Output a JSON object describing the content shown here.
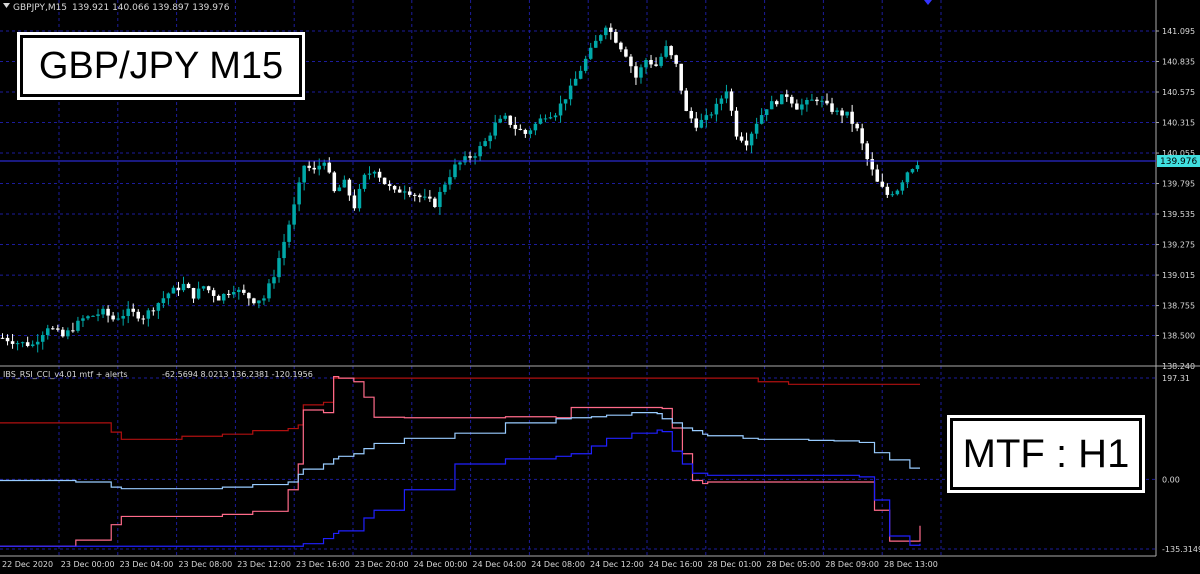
{
  "window": {
    "symbol_header": "GBPJPY,M15",
    "ohlc": "139.921 140.066 139.897 139.976",
    "indicator_header": "IBS_RSI_CCI_v4.01 mtf + alerts",
    "indicator_values": "-62.5694 8.0213 136.2381 -120.1956"
  },
  "overlays": {
    "main_label": "GBP/JPY M15",
    "mtf_label": "MTF : H1"
  },
  "colors": {
    "background": "#000000",
    "grid": "#1c1c9c",
    "axis_text": "#d8d8d8",
    "bull_candle": "#00a8a8",
    "bear_candle": "#ffffff",
    "price_line": "#3333ff",
    "current_price_bg": "#40e0e0",
    "ibs_line": "#b01010",
    "rsi_line": "#ff6b8a",
    "cci_line": "#99ccff",
    "ind4_line": "#2020ff"
  },
  "chart_data": [
    {
      "type": "candlestick",
      "title": "GBPJPY,M15",
      "current_price": 139.976,
      "current_price_label": "139.976",
      "y_ticks": [
        "141.095",
        "140.835",
        "140.575",
        "140.315",
        "140.055",
        "139.795",
        "139.535",
        "139.275",
        "139.015",
        "138.755",
        "138.500",
        "138.240"
      ],
      "ylim": [
        138.24,
        141.3
      ],
      "x_labels": [
        "22 Dec 2020",
        "23 Dec 00:00",
        "23 Dec 04:00",
        "23 Dec 08:00",
        "23 Dec 12:00",
        "23 Dec 16:00",
        "23 Dec 20:00",
        "24 Dec 00:00",
        "24 Dec 04:00",
        "24 Dec 08:00",
        "24 Dec 12:00",
        "24 Dec 16:00",
        "28 Dec 01:00",
        "28 Dec 05:00",
        "28 Dec 09:00",
        "28 Dec 13:00"
      ],
      "close_path": [
        [
          0,
          138.48
        ],
        [
          3,
          138.44
        ],
        [
          6,
          138.42
        ],
        [
          9,
          138.58
        ],
        [
          12,
          138.49
        ],
        [
          16,
          138.64
        ],
        [
          20,
          138.7
        ],
        [
          22,
          138.64
        ],
        [
          25,
          138.7
        ],
        [
          28,
          138.66
        ],
        [
          30,
          138.74
        ],
        [
          33,
          138.86
        ],
        [
          36,
          138.93
        ],
        [
          38,
          138.84
        ],
        [
          40,
          138.92
        ],
        [
          43,
          138.82
        ],
        [
          46,
          138.9
        ],
        [
          50,
          138.8
        ],
        [
          52,
          138.82
        ],
        [
          54,
          139.02
        ],
        [
          56,
          139.3
        ],
        [
          58,
          139.6
        ],
        [
          60,
          139.95
        ],
        [
          62,
          139.9
        ],
        [
          64,
          140.0
        ],
        [
          66,
          139.72
        ],
        [
          68,
          139.8
        ],
        [
          70,
          139.6
        ],
        [
          72,
          139.85
        ],
        [
          74,
          139.92
        ],
        [
          76,
          139.8
        ],
        [
          78,
          139.72
        ],
        [
          80,
          139.75
        ],
        [
          83,
          139.68
        ],
        [
          86,
          139.62
        ],
        [
          88,
          139.8
        ],
        [
          90,
          139.94
        ],
        [
          92,
          140.0
        ],
        [
          94,
          140.05
        ],
        [
          96,
          140.15
        ],
        [
          98,
          140.3
        ],
        [
          100,
          140.35
        ],
        [
          102,
          140.27
        ],
        [
          104,
          140.22
        ],
        [
          106,
          140.3
        ],
        [
          108,
          140.38
        ],
        [
          110,
          140.4
        ],
        [
          113,
          140.6
        ],
        [
          116,
          140.85
        ],
        [
          118,
          141.0
        ],
        [
          120,
          141.15
        ],
        [
          122,
          141.02
        ],
        [
          124,
          140.9
        ],
        [
          126,
          140.7
        ],
        [
          128,
          140.85
        ],
        [
          130,
          140.8
        ],
        [
          132,
          140.95
        ],
        [
          134,
          140.8
        ],
        [
          136,
          140.4
        ],
        [
          138,
          140.3
        ],
        [
          140,
          140.35
        ],
        [
          142,
          140.45
        ],
        [
          144,
          140.6
        ],
        [
          146,
          140.22
        ],
        [
          148,
          140.15
        ],
        [
          150,
          140.32
        ],
        [
          152,
          140.45
        ],
        [
          154,
          140.5
        ],
        [
          156,
          140.55
        ],
        [
          158,
          140.45
        ],
        [
          160,
          140.48
        ],
        [
          162,
          140.52
        ],
        [
          164,
          140.45
        ],
        [
          166,
          140.4
        ],
        [
          168,
          140.38
        ],
        [
          170,
          140.25
        ],
        [
          172,
          140.0
        ],
        [
          174,
          139.8
        ],
        [
          176,
          139.7
        ],
        [
          178,
          139.75
        ],
        [
          180,
          139.9
        ],
        [
          182,
          139.976
        ]
      ],
      "candle_count": 183
    },
    {
      "type": "line",
      "title": "IBS_RSI_CCI_v4.01 mtf + alerts",
      "y_ticks": [
        "197.31",
        "0.00",
        "-135.3149"
      ],
      "ylim": [
        -135.3149,
        197.31
      ],
      "x": [
        0,
        12,
        15,
        22,
        24,
        36,
        44,
        50,
        57,
        59,
        60,
        64,
        66,
        67,
        70,
        72,
        74,
        80,
        90,
        100,
        110,
        113,
        117,
        120,
        125,
        130,
        131,
        133,
        135,
        137,
        139,
        140,
        147,
        150,
        156,
        160,
        165,
        170,
        173,
        176,
        180,
        182
      ],
      "series": [
        {
          "values": [
            110,
            110,
            110,
            92,
            78,
            84,
            88,
            95,
            99,
            106,
            145,
            150,
            197,
            197,
            197,
            197,
            197,
            197,
            197,
            197,
            197,
            197,
            197,
            197,
            197,
            197,
            197,
            197,
            197,
            197,
            197,
            197,
            197,
            190,
            185,
            185,
            185,
            185,
            185,
            185,
            185,
            185
          ]
        },
        {
          "values": [
            -130,
            -130,
            -118,
            -88,
            -72,
            -72,
            -68,
            -62,
            -20,
            30,
            135,
            130,
            200,
            197,
            190,
            160,
            121,
            120,
            120,
            122,
            120,
            140,
            140,
            140,
            140,
            140,
            138,
            100,
            50,
            -2,
            -8,
            -5,
            -5,
            -5,
            -5,
            -5,
            -5,
            -5,
            -60,
            -120,
            -120,
            -90
          ]
        },
        {
          "values": [
            -2,
            -2,
            -5,
            -15,
            -18,
            -18,
            -15,
            -10,
            -5,
            10,
            20,
            30,
            40,
            45,
            50,
            60,
            70,
            80,
            90,
            110,
            118,
            120,
            122,
            125,
            130,
            128,
            118,
            110,
            100,
            95,
            88,
            85,
            80,
            78,
            78,
            76,
            75,
            72,
            52,
            38,
            22,
            22
          ]
        },
        {
          "values": [
            -130,
            -130,
            -130,
            -130,
            -130,
            -130,
            -130,
            -130,
            -130,
            -130,
            -125,
            -115,
            -105,
            -100,
            -100,
            -75,
            -60,
            -20,
            30,
            40,
            45,
            50,
            65,
            80,
            90,
            96,
            93,
            55,
            30,
            12,
            12,
            8,
            8,
            8,
            8,
            8,
            8,
            5,
            -40,
            -110,
            -128,
            -125
          ]
        }
      ]
    }
  ]
}
